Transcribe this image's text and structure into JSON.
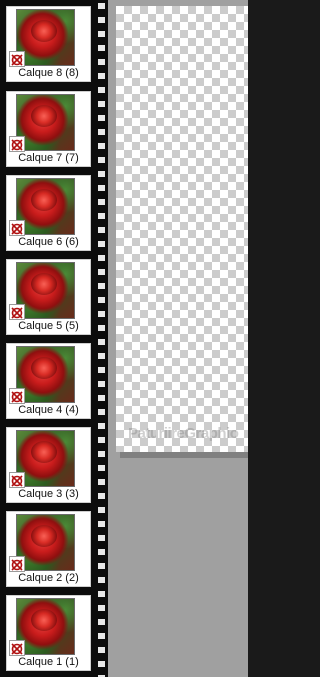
{
  "layers_panel": {
    "layers": [
      {
        "label": "Calque 8 (8)",
        "icon": "rose-thumbnail"
      },
      {
        "label": "Calque 7 (7)",
        "icon": "rose-thumbnail"
      },
      {
        "label": "Calque 6 (6)",
        "icon": "rose-thumbnail"
      },
      {
        "label": "Calque 5 (5)",
        "icon": "rose-thumbnail"
      },
      {
        "label": "Calque 4 (4)",
        "icon": "rose-thumbnail"
      },
      {
        "label": "Calque 3 (3)",
        "icon": "rose-thumbnail"
      },
      {
        "label": "Calque 2 (2)",
        "icon": "rose-thumbnail"
      },
      {
        "label": "Calque 1 (1)",
        "icon": "rose-thumbnail"
      }
    ],
    "visibility_icon": "visibility-toggle-icon"
  },
  "canvas": {
    "watermark": "PaturiireGraphio"
  },
  "colors": {
    "film_strip": "#0c0c0c",
    "sprocket": "#e8e8e8",
    "workspace": "#a0a0a0",
    "checker_light": "#ffffff",
    "checker_dark": "#cccccc"
  }
}
